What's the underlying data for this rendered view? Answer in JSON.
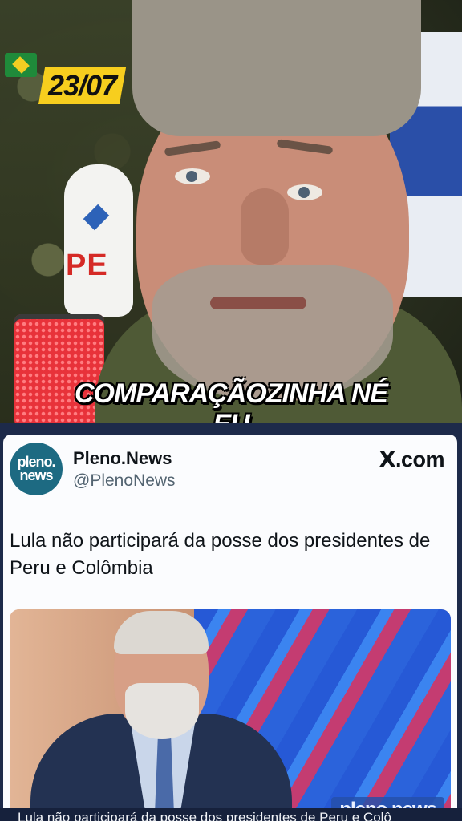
{
  "video": {
    "date_badge": "23/07",
    "mic_label": "PE",
    "caption_line1": "COMPARAÇÃOZINHA NÉ",
    "caption_line2": "EU"
  },
  "tweet": {
    "avatar_line1": "pleno.",
    "avatar_line2": "news",
    "account_name": "Pleno.News",
    "account_handle": "@PlenoNews",
    "source_mark": "X",
    "source_suffix": ".com",
    "text": "Lula não participará da posse dos presidentes de Peru e Colômbia",
    "image_brand": "pleno.news",
    "subtitle": "Lula não participará da posse dos presidentes de Peru e Colô"
  },
  "colors": {
    "badge": "#f7ce1e",
    "mic_red": "#d52a26",
    "avatar_bg": "#1d6a82",
    "handle_gray": "#536471"
  }
}
